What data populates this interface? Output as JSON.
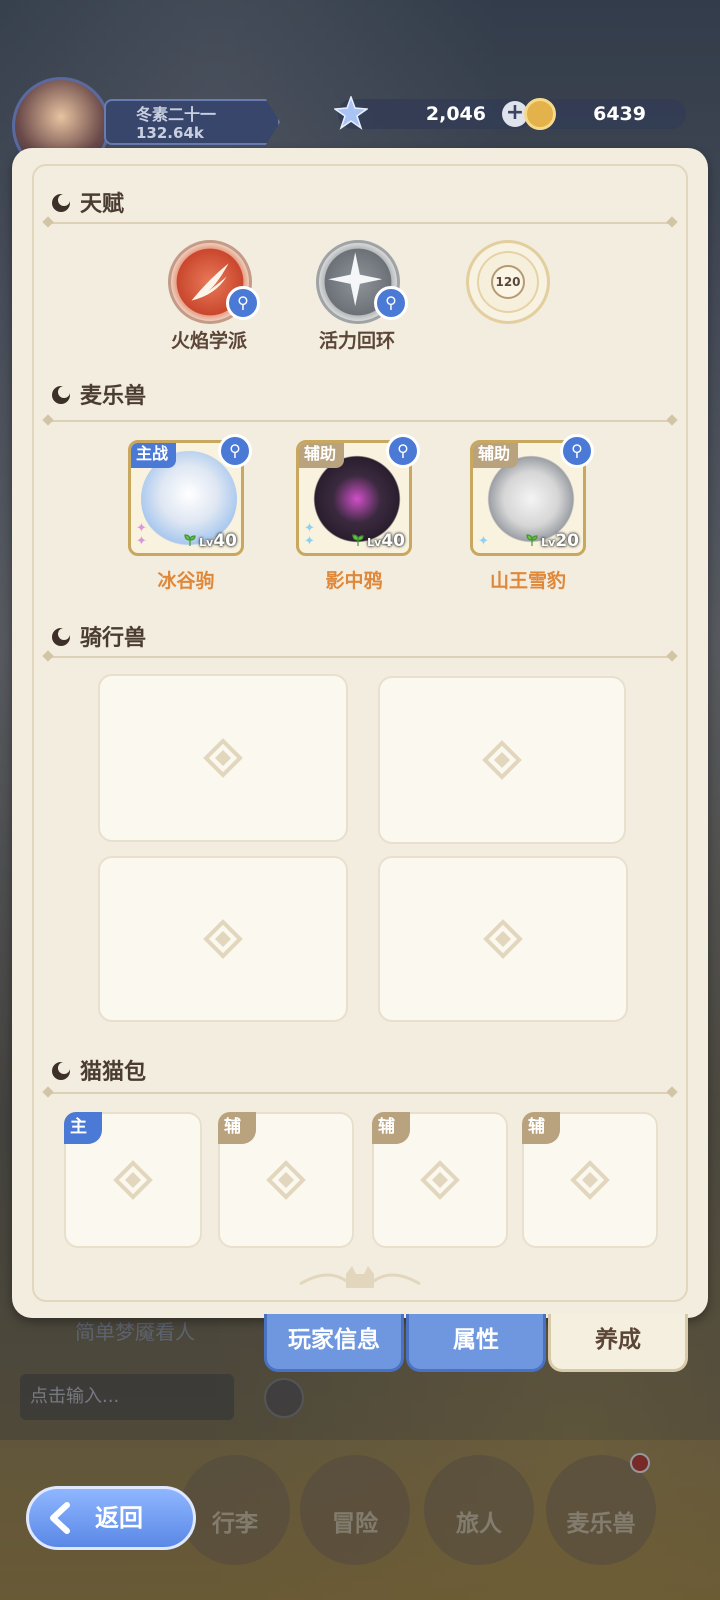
{
  "header": {
    "player_name": "冬素二十一",
    "power": "132.64k",
    "crystals": "2,046",
    "coins": "6439"
  },
  "sections": {
    "talent": "天赋",
    "pets": "麦乐兽",
    "mounts": "骑行兽",
    "cat_bags": "猫猫包"
  },
  "talents": [
    {
      "name": "火焰学派"
    },
    {
      "name": "活力回环"
    },
    {
      "name": "120"
    }
  ],
  "pets": [
    {
      "role": "主战",
      "name": "冰谷驹",
      "level": "40"
    },
    {
      "role": "辅助",
      "name": "影中鸦",
      "level": "40"
    },
    {
      "role": "辅助",
      "name": "山王雪豹",
      "level": "20"
    }
  ],
  "cat_bag_tags": [
    "主",
    "辅",
    "辅",
    "辅"
  ],
  "tabs": {
    "player_info": "玩家信息",
    "attributes": "属性",
    "growth": "养成"
  },
  "chat": {
    "last_message": "简单梦魇看人",
    "input_placeholder": "点击输入..."
  },
  "nav": {
    "back": "返回",
    "items": [
      "行李",
      "冒险",
      "旅人",
      "麦乐兽"
    ]
  },
  "colors": {
    "accent_blue": "#4b79d6",
    "pet_name_orange": "#e0883a",
    "panel_bg": "#f3ede0"
  }
}
